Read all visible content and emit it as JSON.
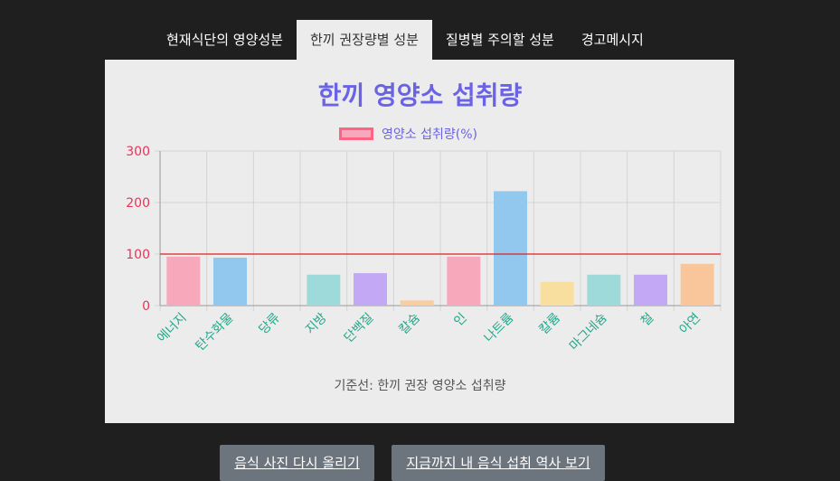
{
  "tabs": [
    {
      "label": "현재식단의 영양성분",
      "active": false
    },
    {
      "label": "한끼 권장량별 성분",
      "active": true
    },
    {
      "label": "질병별 주의할 성분",
      "active": false
    },
    {
      "label": "경고메시지",
      "active": false
    }
  ],
  "chart_data": {
    "type": "bar",
    "title": "한끼 영양소 섭취량",
    "legend": {
      "position": "top",
      "label": "영양소 섭취량(%)"
    },
    "categories": [
      "에너지",
      "탄수화물",
      "당류",
      "지방",
      "단백질",
      "칼슘",
      "인",
      "나트륨",
      "칼륨",
      "마그네슘",
      "철",
      "아연"
    ],
    "series": [
      {
        "name": "영양소 섭취량(%)",
        "values": [
          95,
          93,
          0,
          60,
          63,
          10,
          95,
          222,
          46,
          60,
          60,
          81
        ]
      }
    ],
    "colors": [
      "#f7a8bb",
      "#93c8ee",
      "#93c8ee",
      "#9fdada",
      "#c3a9f5",
      "#f8cd9f",
      "#f7a8bb",
      "#93c8ee",
      "#f8dfa0",
      "#9fdada",
      "#c3a9f5",
      "#f8c69a"
    ],
    "ylim": [
      0,
      300
    ],
    "yticks": [
      0,
      100,
      200,
      300
    ],
    "grid": true,
    "reference_line": {
      "value": 100,
      "color": "#e02020"
    },
    "tick_color_y": "#e8335a",
    "tick_color_x": "#22a88a"
  },
  "baseline_note": "기준선: 한끼 권장 영양소 섭취량",
  "buttons": {
    "reupload": "음식 사진 다시 올리기",
    "history": "지금까지 내 음식 섭취 역사 보기"
  }
}
